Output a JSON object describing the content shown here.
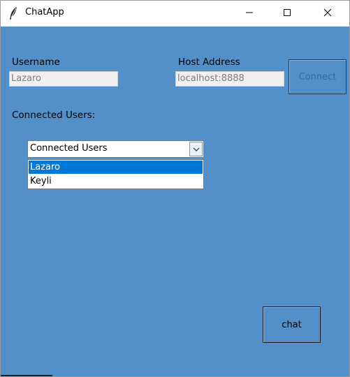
{
  "window": {
    "title": "ChatApp",
    "icon": "feather-icon",
    "controls": [
      "minimize-icon",
      "maximize-icon",
      "close-icon"
    ],
    "background_color": "#5390c9"
  },
  "form": {
    "username_label": "Username",
    "username_value": "Lazaro",
    "host_label": "Host Address",
    "host_value": "localhost:8888",
    "connect_label": "Connect",
    "users_label": "Connected Users:"
  },
  "users_combo": {
    "selected": "Connected Users",
    "options": [
      "Lazaro",
      "Keyli"
    ],
    "highlighted": "Lazaro"
  },
  "actions": {
    "chat_label": "chat"
  }
}
